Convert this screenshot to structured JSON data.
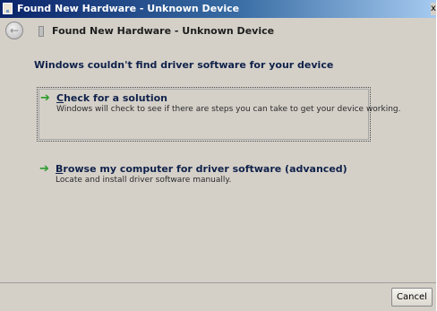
{
  "window": {
    "title": "Found New Hardware - Unknown Device",
    "close_glyph": "x"
  },
  "navbar": {
    "back_icon": "back-arrow-icon",
    "title": "Found New Hardware - Unknown Device"
  },
  "main": {
    "heading": "Windows couldn't find driver software for your device",
    "options": [
      {
        "accel": "C",
        "label_rest": "heck for a solution",
        "description": "Windows will check to see if there are steps you can take to get your device working.",
        "icon": "green-arrow-icon",
        "focused": true
      },
      {
        "accel": "B",
        "label_rest": "rowse my computer for driver software (advanced)",
        "description": "Locate and install driver software manually.",
        "icon": "green-arrow-icon",
        "focused": false
      }
    ]
  },
  "footer": {
    "cancel_label": "Cancel"
  },
  "colors": {
    "background": "#d4d0c8",
    "heading_text": "#10214a",
    "arrow_green": "#2d9a2d",
    "titlebar_start": "#0a246a"
  }
}
